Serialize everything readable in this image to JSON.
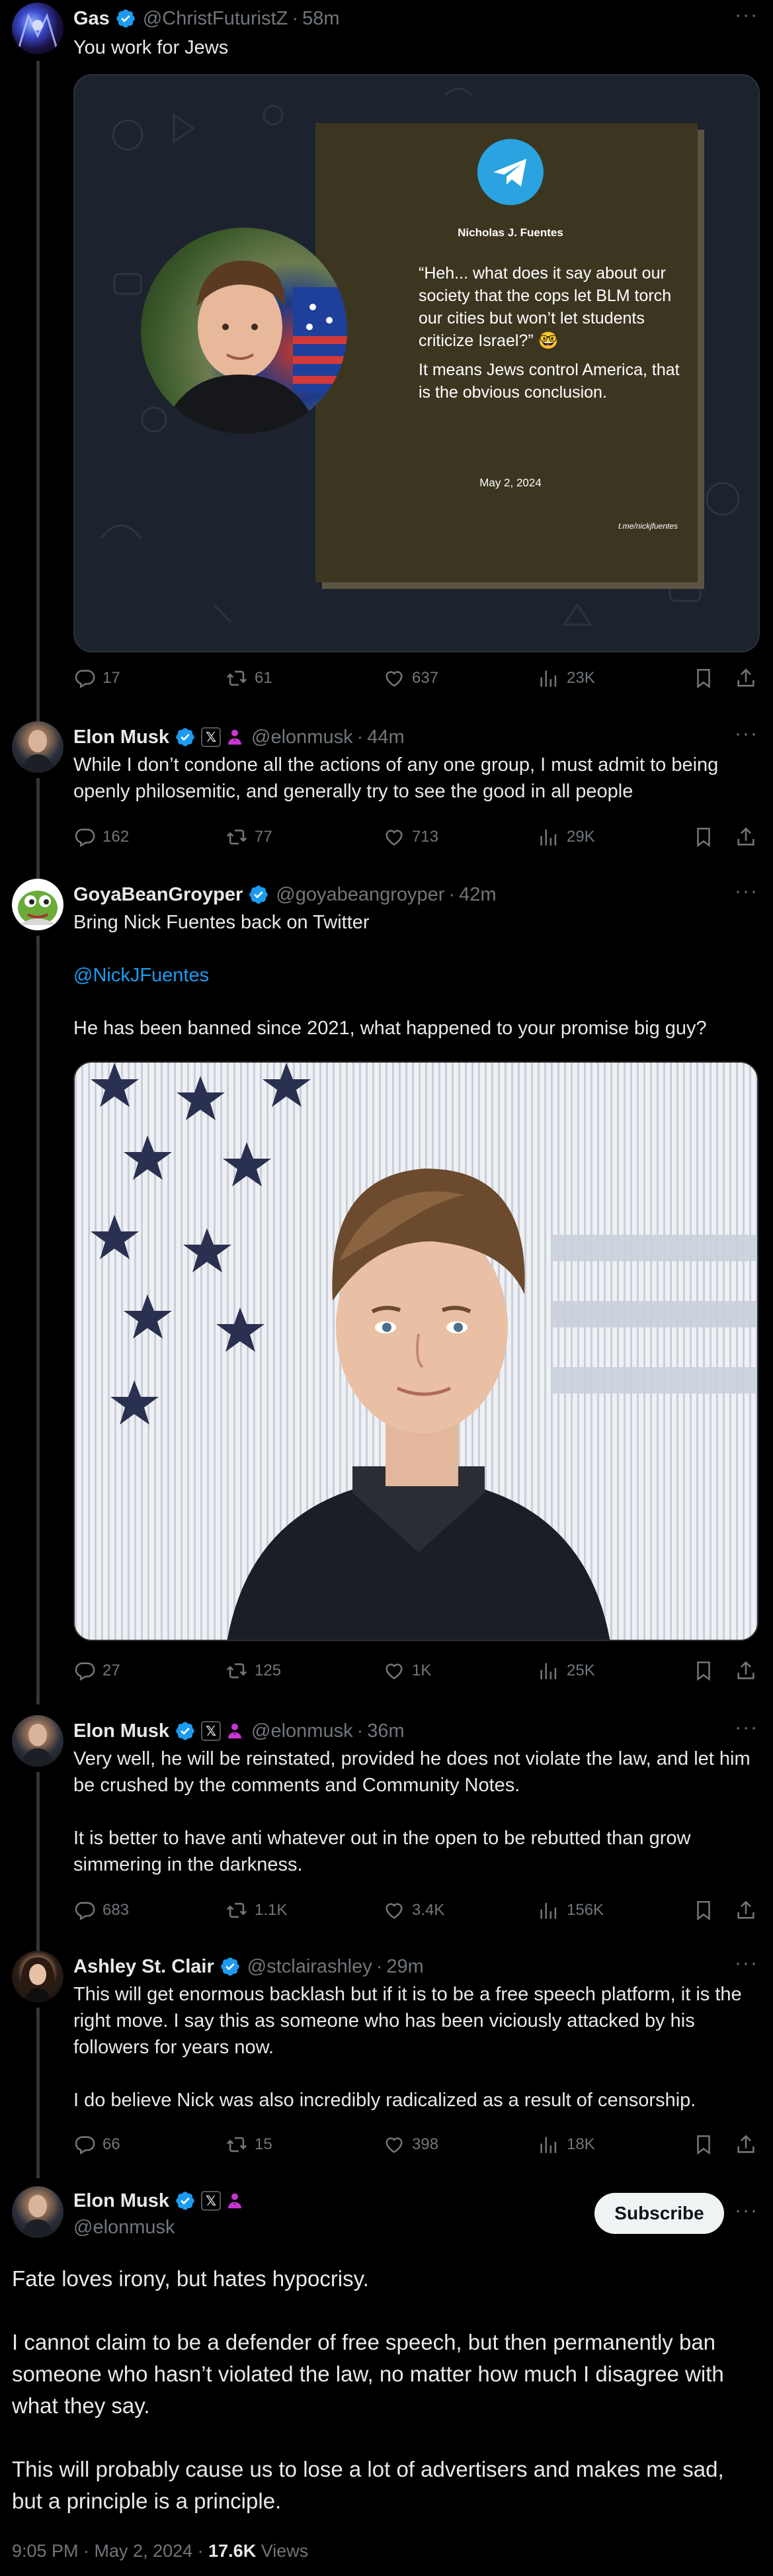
{
  "tweets": [
    {
      "name": "Gas",
      "handle": "@ChristFuturistZ",
      "time": "58m",
      "text": [
        "You work for Jews"
      ],
      "card": {
        "author": "Nicholas J. Fuentes",
        "quote": "“Heh... what does it say about our society that the cops let BLM torch our cities but won’t let students criticize Israel?” 🤓",
        "answer": "It means Jews control America, that is the obvious conclusion.",
        "date": "May 2, 2024",
        "source": "t.me/nickjfuentes"
      },
      "stats": {
        "replies": "17",
        "reposts": "61",
        "likes": "637",
        "views": "23K"
      }
    },
    {
      "name": "Elon Musk",
      "handle": "@elonmusk",
      "time": "44m",
      "text": [
        "While I don’t condone all the actions of any one group, I must admit to being openly philosemitic, and generally try to see the good in all people"
      ],
      "stats": {
        "replies": "162",
        "reposts": "77",
        "likes": "713",
        "views": "29K"
      }
    },
    {
      "name": "GoyaBeanGroyper",
      "handle": "@goyabeangroyper",
      "time": "42m",
      "text": [
        "Bring Nick Fuentes back on Twitter",
        "@NickJFuentes",
        "He has been banned since 2021, what happened to your promise big guy?"
      ],
      "stats": {
        "replies": "27",
        "reposts": "125",
        "likes": "1K",
        "views": "25K"
      }
    },
    {
      "name": "Elon Musk",
      "handle": "@elonmusk",
      "time": "36m",
      "text": [
        "Very well, he will be reinstated, provided he does not violate the law, and let him be crushed by the comments and Community Notes.",
        "It is better to have anti whatever out in the open to be rebutted than grow simmering in the darkness."
      ],
      "stats": {
        "replies": "683",
        "reposts": "1.1K",
        "likes": "3.4K",
        "views": "156K"
      }
    },
    {
      "name": "Ashley St. Clair",
      "handle": "@stclairashley",
      "time": "29m",
      "text": [
        "This will get enormous backlash but if it is to be a free speech platform, it is the right move. I say this as someone who has been viciously attacked by his followers for years now.",
        "I do believe Nick was also incredibly radicalized as a result of censorship."
      ],
      "stats": {
        "replies": "66",
        "reposts": "15",
        "likes": "398",
        "views": "18K"
      }
    }
  ],
  "main": {
    "name": "Elon Musk",
    "handle": "@elonmusk",
    "subscribe_label": "Subscribe",
    "text": [
      "Fate loves irony, but hates hypocrisy.",
      "I cannot claim to be a defender of free speech, but then permanently ban someone who hasn’t violated the law, no matter how much I disagree with what they say.",
      "This will probably cause us to lose a lot of advertisers and makes me sad, but a principle is a principle."
    ],
    "time": "9:05 PM · May 2, 2024 · ",
    "views_count": "17.6K",
    "views_label": "Views"
  },
  "colors": {
    "accent": "#1d9bf0",
    "muted": "#71767b",
    "text": "#e7e9ea",
    "background": "#000000"
  },
  "icons": [
    "verified-badge-icon",
    "x-logo-icon",
    "x-premium-badge-icon",
    "reply-icon",
    "repost-icon",
    "like-icon",
    "views-icon",
    "bookmark-icon",
    "share-icon",
    "more-icon",
    "telegram-icon"
  ]
}
